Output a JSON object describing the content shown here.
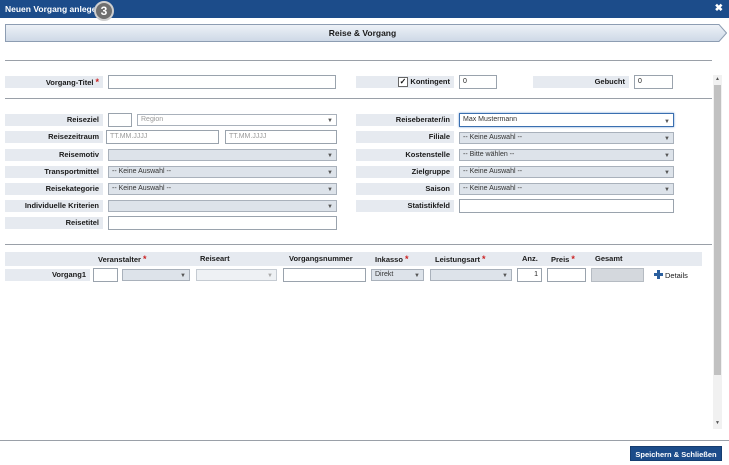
{
  "window": {
    "title": "Neuen Vorgang anlegen",
    "badge": "3",
    "close": "✖"
  },
  "step": {
    "label": "Reise & Vorgang"
  },
  "header": {
    "vorgang_titel_label": "Vorgang-Titel",
    "vorgang_titel_value": "",
    "kontingent_label": "Kontingent",
    "kontingent_checked": "✓",
    "kontingent_value": "0",
    "gebucht_label": "Gebucht",
    "gebucht_value": "0"
  },
  "left": {
    "reiseziel_label": "Reiseziel",
    "region_placeholder": "Region",
    "reisezeitraum_label": "Reisezeitraum",
    "date_from_placeholder": "TT.MM.JJJJ",
    "date_to_placeholder": "TT.MM.JJJJ",
    "reisemotiv_label": "Reisemotiv",
    "reisemotiv_value": "",
    "transportmittel_label": "Transportmittel",
    "transportmittel_value": "-- Keine Auswahl --",
    "reisekategorie_label": "Reisekategorie",
    "reisekategorie_value": "-- Keine Auswahl --",
    "kriterien_label": "Individuelle Kriterien",
    "kriterien_value": "",
    "reisetitel_label": "Reisetitel",
    "reisetitel_value": ""
  },
  "right": {
    "berater_label": "Reiseberater/in",
    "berater_value": "Max Mustermann",
    "filiale_label": "Filiale",
    "filiale_value": "-- Keine Auswahl --",
    "kostenstelle_label": "Kostenstelle",
    "kostenstelle_value": "-- Bitte wählen --",
    "zielgruppe_label": "Zielgruppe",
    "zielgruppe_value": "-- Keine Auswahl --",
    "saison_label": "Saison",
    "saison_value": "-- Keine Auswahl --",
    "statistikfeld_label": "Statistikfeld",
    "statistikfeld_value": ""
  },
  "table": {
    "columns": {
      "veranstalter": "Veranstalter",
      "reiseart": "Reiseart",
      "vorgangsnummer": "Vorgangsnummer",
      "inkasso": "Inkasso",
      "leistungsart": "Leistungsart",
      "anz": "Anz.",
      "preis": "Preis",
      "gesamt": "Gesamt"
    },
    "required_mark": "*",
    "row": {
      "label": "Vorgang1",
      "inkasso_value": "Direkt",
      "anz_value": "1",
      "preis_value": "",
      "details_label": "Details"
    }
  },
  "footer": {
    "save_label": "Speichern & Schließen"
  },
  "icons": {
    "caret": "caret-down-icon",
    "plus": "plus-icon",
    "check": "check-icon"
  },
  "colors": {
    "brand": "#1c4c8a",
    "label_bg": "#e6eaf0",
    "required": "#cc2222"
  }
}
